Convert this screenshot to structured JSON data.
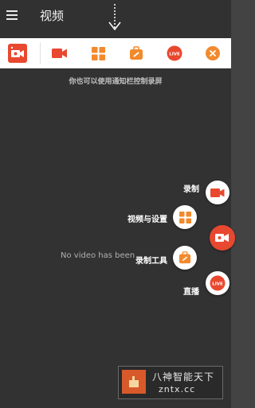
{
  "app_bar": {
    "title": "视频"
  },
  "notification_bar": {
    "items": [
      {
        "name": "app-logo-icon"
      },
      {
        "name": "record-icon"
      },
      {
        "name": "grid-icon"
      },
      {
        "name": "toolbox-icon"
      },
      {
        "name": "live-icon",
        "label": "LIVE"
      },
      {
        "name": "close-icon"
      }
    ]
  },
  "hint_text": "你也可以使用通知栏控制录屏",
  "empty_message": "No video has been",
  "fab_menu": {
    "record_label": "录制",
    "video_settings_label": "视频与设置",
    "tools_label": "录制工具",
    "live_label": "直播",
    "live_badge": "LIVE"
  },
  "watermark": {
    "cn": "八神智能天下",
    "en": "zntx.cc"
  },
  "colors": {
    "accent": "#e8482f",
    "orange": "#f28a2d",
    "background": "#434343",
    "appbar": "#313131"
  }
}
